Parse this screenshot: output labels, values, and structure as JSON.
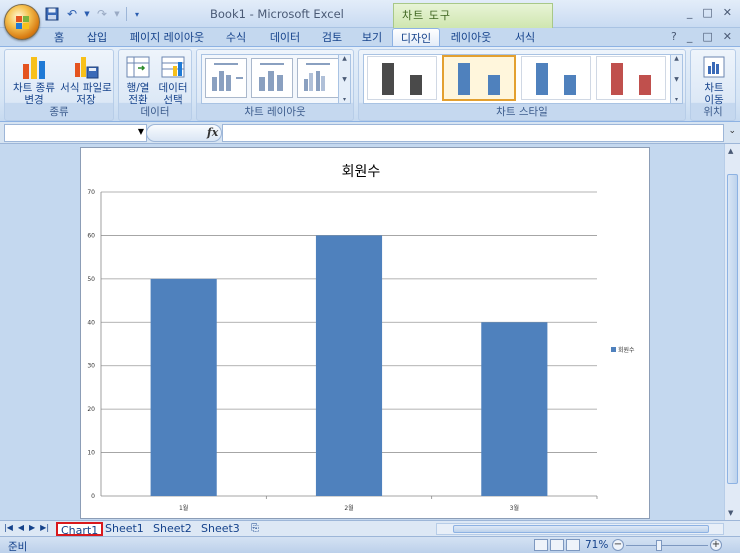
{
  "window": {
    "title": "Book1 - Microsoft Excel",
    "context_tab_group": "차트 도구",
    "controls": [
      "_",
      "□",
      "✕"
    ],
    "ribbon_controls": [
      "?",
      "_",
      "□",
      "✕"
    ]
  },
  "ribbon_tabs": [
    {
      "label": "홈",
      "active": false
    },
    {
      "label": "삽입",
      "active": false
    },
    {
      "label": "페이지 레이아웃",
      "active": false
    },
    {
      "label": "수식",
      "active": false
    },
    {
      "label": "데이터",
      "active": false
    },
    {
      "label": "검토",
      "active": false
    },
    {
      "label": "보기",
      "active": false
    },
    {
      "label": "디자인",
      "active": true
    },
    {
      "label": "레이아웃",
      "active": false
    },
    {
      "label": "서식",
      "active": false
    }
  ],
  "ribbon": {
    "type_group": {
      "label": "종류",
      "change_type": [
        "차트 종류",
        "변경"
      ],
      "save_template": [
        "서식 파일로",
        "저장"
      ]
    },
    "data_group": {
      "label": "데이터",
      "switch_row_col": [
        "행/열",
        "전환"
      ],
      "select_data": [
        "데이터",
        "선택"
      ]
    },
    "layouts_group": {
      "label": "차트 레이아웃"
    },
    "styles_group": {
      "label": "차트 스타일",
      "thumb_colors": [
        "#4a4a4a",
        "#4f81bd",
        "#4f81bd",
        "#c0504d"
      ]
    },
    "location_group": {
      "label": "위치",
      "move_chart": [
        "차트",
        "이동"
      ]
    }
  },
  "formula_bar": {
    "name_box_value": "",
    "formula_value": "",
    "fx_label": "fx"
  },
  "chart_data": {
    "type": "bar",
    "title": "회원수",
    "categories": [
      "1월",
      "2월",
      "3월"
    ],
    "series": [
      {
        "name": "회원수",
        "values": [
          50,
          60,
          40
        ],
        "color": "#4f81bd"
      }
    ],
    "ylim": [
      0,
      70
    ],
    "yticks": [
      0,
      10,
      20,
      30,
      40,
      50,
      60,
      70
    ],
    "grid": true,
    "legend": "right"
  },
  "sheet_tabs": [
    {
      "label": "Chart1",
      "active": true
    },
    {
      "label": "Sheet1",
      "active": false
    },
    {
      "label": "Sheet2",
      "active": false
    },
    {
      "label": "Sheet3",
      "active": false
    }
  ],
  "status_bar": {
    "status": "준비",
    "zoom": "71%",
    "zoom_fraction": 0.4
  }
}
